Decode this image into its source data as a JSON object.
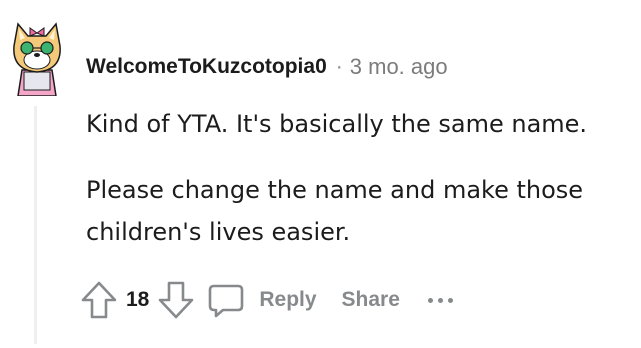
{
  "comment": {
    "author": "WelcomeToKuzcotopia0",
    "separator": "·",
    "time_ago": "3 mo. ago",
    "paragraphs": [
      "Kind of YTA. It's basically the same name.",
      "Please change the name and make those",
      "children's lives easier."
    ],
    "vote_count": "18",
    "reply_label": "Reply",
    "share_label": "Share"
  },
  "icons": {
    "upvote": "arrow-up-icon",
    "downvote": "arrow-down-icon",
    "reply": "speech-bubble-icon",
    "more": "ellipsis-icon"
  },
  "colors": {
    "text": "#1c1c1c",
    "muted": "#878a8c",
    "thread_line": "#edeff1"
  }
}
